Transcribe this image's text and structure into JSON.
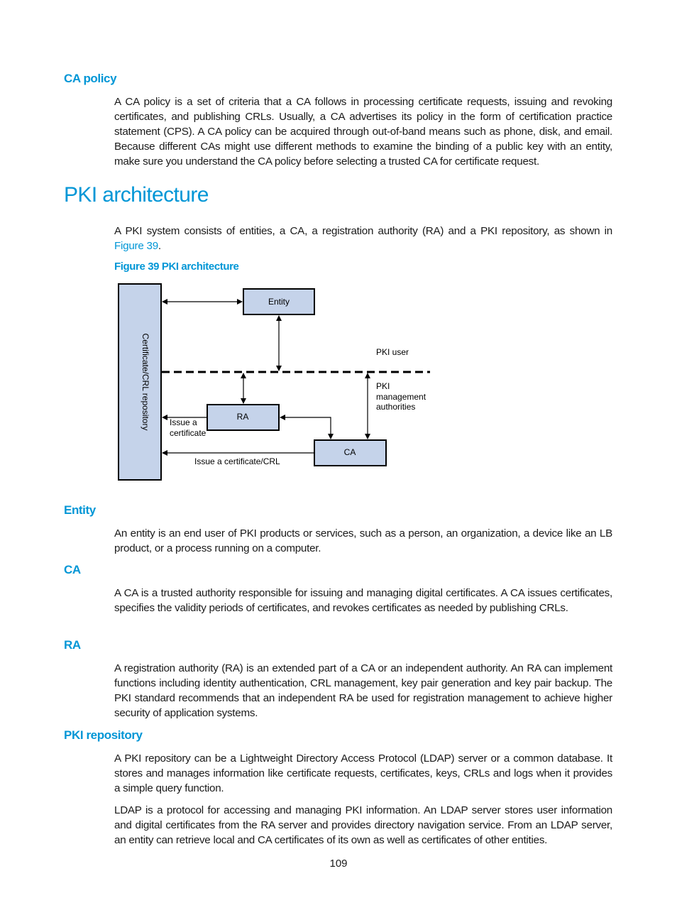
{
  "sections": {
    "ca_policy": {
      "heading": "CA policy",
      "body": "A CA policy is a set of criteria that a CA follows in processing certificate requests, issuing and revoking certificates, and publishing CRLs. Usually, a CA advertises its policy in the form of certification practice statement (CPS). A CA policy can be acquired through out-of-band means such as phone, disk, and email. Because different CAs might use different methods to examine the binding of a public key with an entity, make sure you understand the CA policy before selecting a trusted CA for certificate request."
    },
    "pki_architecture": {
      "heading": "PKI architecture",
      "intro_before_link": "A PKI system consists of entities, a CA, a registration authority (RA) and a PKI repository, as shown in ",
      "intro_link": "Figure 39",
      "intro_after_link": ".",
      "figure_caption": "Figure 39 PKI architecture"
    },
    "entity": {
      "heading": "Entity",
      "body": "An entity is an end user of PKI products or services, such as a person, an organization, a device like an LB product, or a process running on a computer."
    },
    "ca": {
      "heading": "CA",
      "body": "A CA is a trusted authority responsible for issuing and managing digital certificates. A CA issues certificates, specifies the validity periods of certificates, and revokes certificates as needed by publishing CRLs."
    },
    "ra": {
      "heading": "RA",
      "body": "A registration authority (RA) is an extended part of a CA or an independent authority. An RA can implement functions including identity authentication, CRL management, key pair generation and key pair backup. The PKI standard recommends that an independent RA be used for registration management to achieve higher security of application systems."
    },
    "pki_repository": {
      "heading": "PKI repository",
      "body1": "A PKI repository can be a Lightweight Directory Access Protocol (LDAP) server or a common database. It stores and manages information like certificate requests, certificates, keys, CRLs and logs when it provides a simple query function.",
      "body2": "LDAP is a protocol for accessing and managing PKI information. An LDAP server stores user information and digital certificates from the RA server and provides directory navigation service. From an LDAP server, an entity can retrieve local and CA certificates of its own as well as certificates of other entities."
    }
  },
  "diagram": {
    "repository_label": "Certificate/CRL repository",
    "entity_label": "Entity",
    "ra_label": "RA",
    "ca_label": "CA",
    "pki_user_label": "PKI user",
    "pki_mgmt_label_lines": [
      "PKI",
      "management",
      "authorities"
    ],
    "issue_cert_lines": [
      "Issue a",
      "certificate"
    ],
    "issue_cert_crl_label": "Issue a certificate/CRL",
    "box_fill": "#c5d3ea"
  },
  "footer": {
    "page_number": "109"
  },
  "colors": {
    "accent": "#0096d6"
  }
}
